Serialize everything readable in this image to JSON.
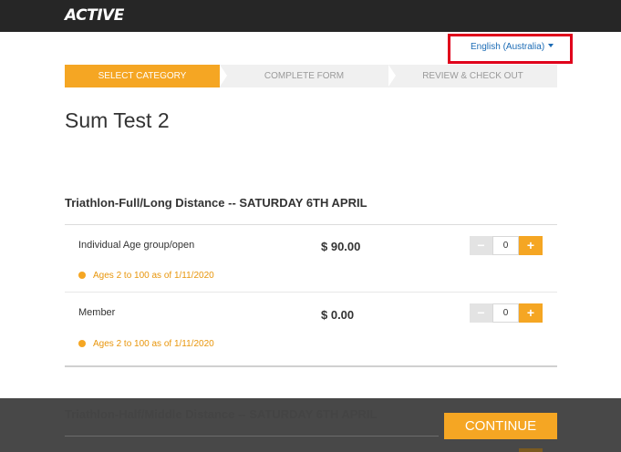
{
  "header": {
    "logo_text": "ACTIVE"
  },
  "language": {
    "label": "English (Australia)"
  },
  "steps": [
    {
      "label": "SELECT CATEGORY",
      "active": true
    },
    {
      "label": "COMPLETE FORM",
      "active": false
    },
    {
      "label": "REVIEW & CHECK OUT",
      "active": false
    }
  ],
  "page_title": "Sum Test 2",
  "sections": [
    {
      "title": "Triathlon-Full/Long Distance -- SATURDAY 6TH APRIL",
      "items": [
        {
          "name": "Individual Age group/open",
          "price": "$ 90.00",
          "note": "Ages 2 to 100 as of 1/11/2020",
          "qty": "0",
          "minus": "−",
          "plus": "+"
        },
        {
          "name": "Member",
          "price": "$ 0.00",
          "note": "Ages 2 to 100 as of 1/11/2020",
          "qty": "0",
          "minus": "−",
          "plus": "+"
        }
      ]
    },
    {
      "title": "Triathlon-Half/Middle Distance -- SATURDAY 6TH APRIL"
    }
  ],
  "footer": {
    "continue_label": "CONTINUE"
  },
  "colors": {
    "accent": "#f5a623",
    "topbar": "#262626",
    "link": "#1b6bb5",
    "highlight_border": "#e0001b"
  }
}
